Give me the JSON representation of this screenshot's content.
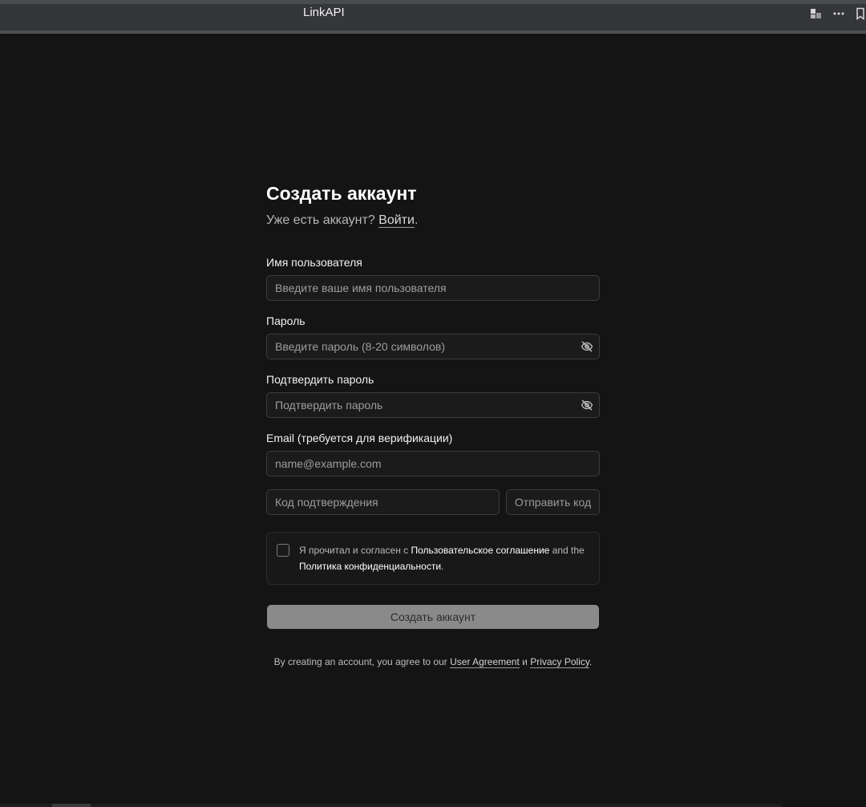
{
  "window": {
    "title": "LinkAPI",
    "icons": [
      "extensions-icon",
      "more-icon",
      "bookmark-icon"
    ]
  },
  "form": {
    "heading": "Создать аккаунт",
    "subtitle_prefix": "Уже есть аккаунт?",
    "login_link": "Войти",
    "subtitle_suffix": ".",
    "username": {
      "label": "Имя пользователя",
      "placeholder": "Введите ваше имя пользователя",
      "value": ""
    },
    "password": {
      "label": "Пароль",
      "placeholder": "Введите пароль (8-20 символов)",
      "value": ""
    },
    "confirm_password": {
      "label": "Подтвердить пароль",
      "placeholder": "Подтвердить пароль",
      "value": ""
    },
    "email": {
      "label": "Email (требуется для верификации)",
      "placeholder": "name@example.com",
      "value": ""
    },
    "code": {
      "placeholder": "Код подтверждения",
      "value": "",
      "send_label": "Отправить код"
    },
    "agreement": {
      "checked": false,
      "text_prefix": "Я прочитал и согласен с ",
      "user_agreement": "Пользовательское соглашение",
      "conjunction": " and the ",
      "privacy_policy": "Политика конфиденциальности",
      "text_suffix": "."
    },
    "submit_label": "Создать аккаунт",
    "footer": {
      "prefix": "By creating an account, you agree to our ",
      "user_agreement": "User Agreement",
      "conjunction": " и ",
      "privacy_policy": "Privacy Policy",
      "suffix": "."
    }
  },
  "colors": {
    "background": "#141414",
    "titlebar": "#35363a",
    "submit_disabled": "#8a8a8a"
  }
}
